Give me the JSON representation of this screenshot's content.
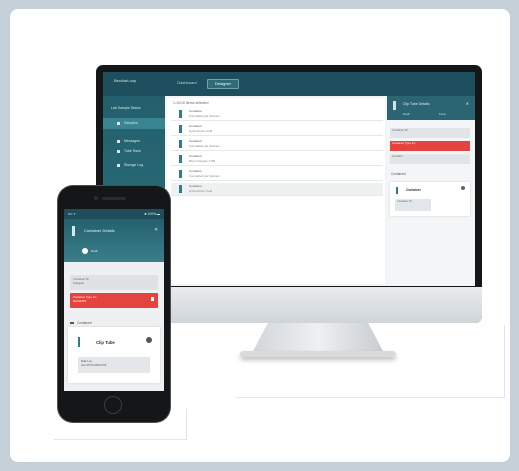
{
  "desktop": {
    "brand": "BecklarLoop",
    "tabs": [
      "Dashboard",
      "Designer"
    ],
    "sidebar": {
      "select": "Lab Sample Status",
      "items": [
        "Samples",
        "Messages",
        "Tube Rack",
        "Storage Log"
      ]
    },
    "list": {
      "header": "1-10/15 Items selected",
      "rows": [
        {
          "line1": "Container",
          "line2": "Formaldehyde Solution"
        },
        {
          "line1": "Container",
          "line2": "Hydrochloric Acid"
        },
        {
          "line1": "Container",
          "line2": "Formaldehyde Solution"
        },
        {
          "line1": "Container",
          "line2": "Blood Sample 1756"
        },
        {
          "line1": "Container",
          "line2": "Formaldehyde Solution"
        },
        {
          "line1": "Container",
          "line2": "Hydrochloric Acid"
        }
      ]
    },
    "detail": {
      "title": "Clip Tube Details",
      "radio_options": [
        "Draft",
        "Final"
      ],
      "fields": [
        "Container ID",
        "Container Type Inc",
        "Location"
      ],
      "section": "Contained",
      "card_title": "Container",
      "card_field": "Container ID"
    }
  },
  "phone": {
    "status_left": "•••• ✦",
    "status_right": "✱ 100% ▬",
    "header_title": "Container Details",
    "radio_label": "Draft",
    "fields": [
      {
        "label": "Container ID",
        "value": "Pelagate"
      },
      {
        "label": "Container Type Inc",
        "value": "ReCW4V0"
      }
    ],
    "section": "Contained",
    "card_title": "Clip Tube",
    "card_field_label": "Bulk Log",
    "card_field_value": "ALLSTNS-0000 P05"
  },
  "colors": {
    "teal_dark": "#1e4f5e",
    "teal": "#2f7b89",
    "alert_red": "#e4443d",
    "background": "#c5d0d8"
  }
}
